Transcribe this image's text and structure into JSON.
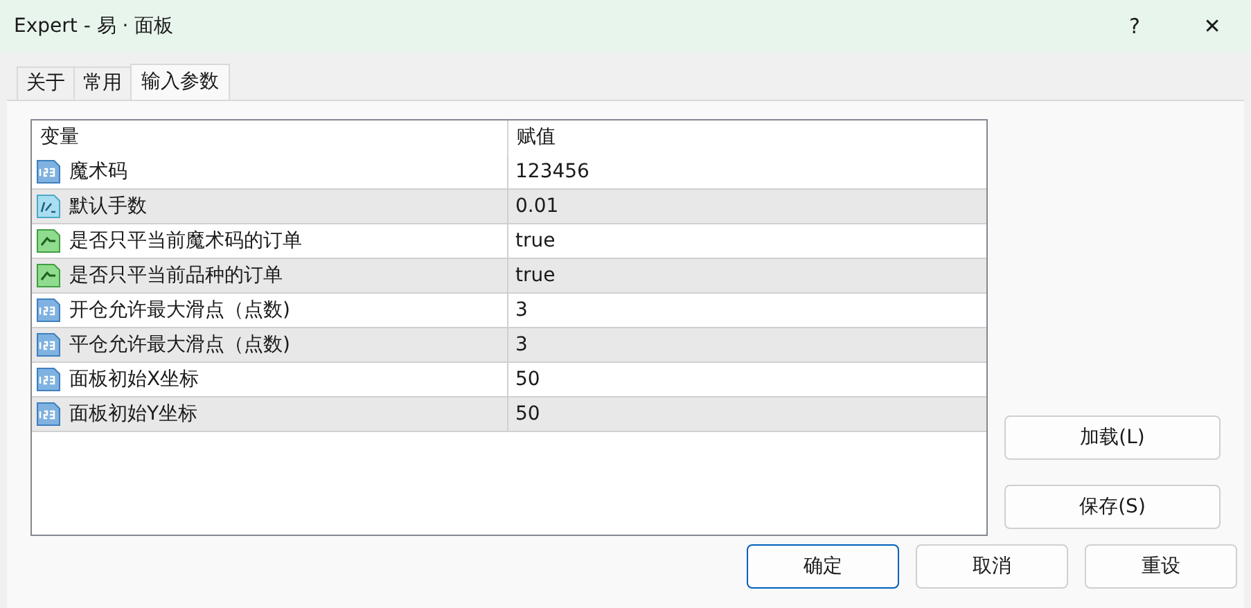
{
  "window": {
    "title": "Expert - 易 · 面板",
    "help": "?",
    "close": "✕"
  },
  "tabs": [
    {
      "label": "关于",
      "selected": false
    },
    {
      "label": "常用",
      "selected": false
    },
    {
      "label": "输入参数",
      "selected": true
    }
  ],
  "table": {
    "columns": [
      "变量",
      "赋值"
    ],
    "rows": [
      {
        "kind": "int",
        "name": "魔术码",
        "value": "123456"
      },
      {
        "kind": "double",
        "name": "默认手数",
        "value": "0.01"
      },
      {
        "kind": "bool",
        "name": "是否只平当前魔术码的订单",
        "value": "true"
      },
      {
        "kind": "bool",
        "name": "是否只平当前品种的订单",
        "value": "true"
      },
      {
        "kind": "int",
        "name": "开仓允许最大滑点（点数)",
        "value": "3"
      },
      {
        "kind": "int",
        "name": "平仓允许最大滑点（点数)",
        "value": "3"
      },
      {
        "kind": "int",
        "name": "面板初始X坐标",
        "value": "50"
      },
      {
        "kind": "int",
        "name": "面板初始Y坐标",
        "value": "50"
      }
    ]
  },
  "side_buttons": [
    {
      "label": "加载(L)"
    },
    {
      "label": "保存(S)"
    }
  ],
  "buttons": [
    {
      "label": "确定",
      "default": true
    },
    {
      "label": "取消",
      "default": false
    },
    {
      "label": "重设",
      "default": false
    }
  ]
}
